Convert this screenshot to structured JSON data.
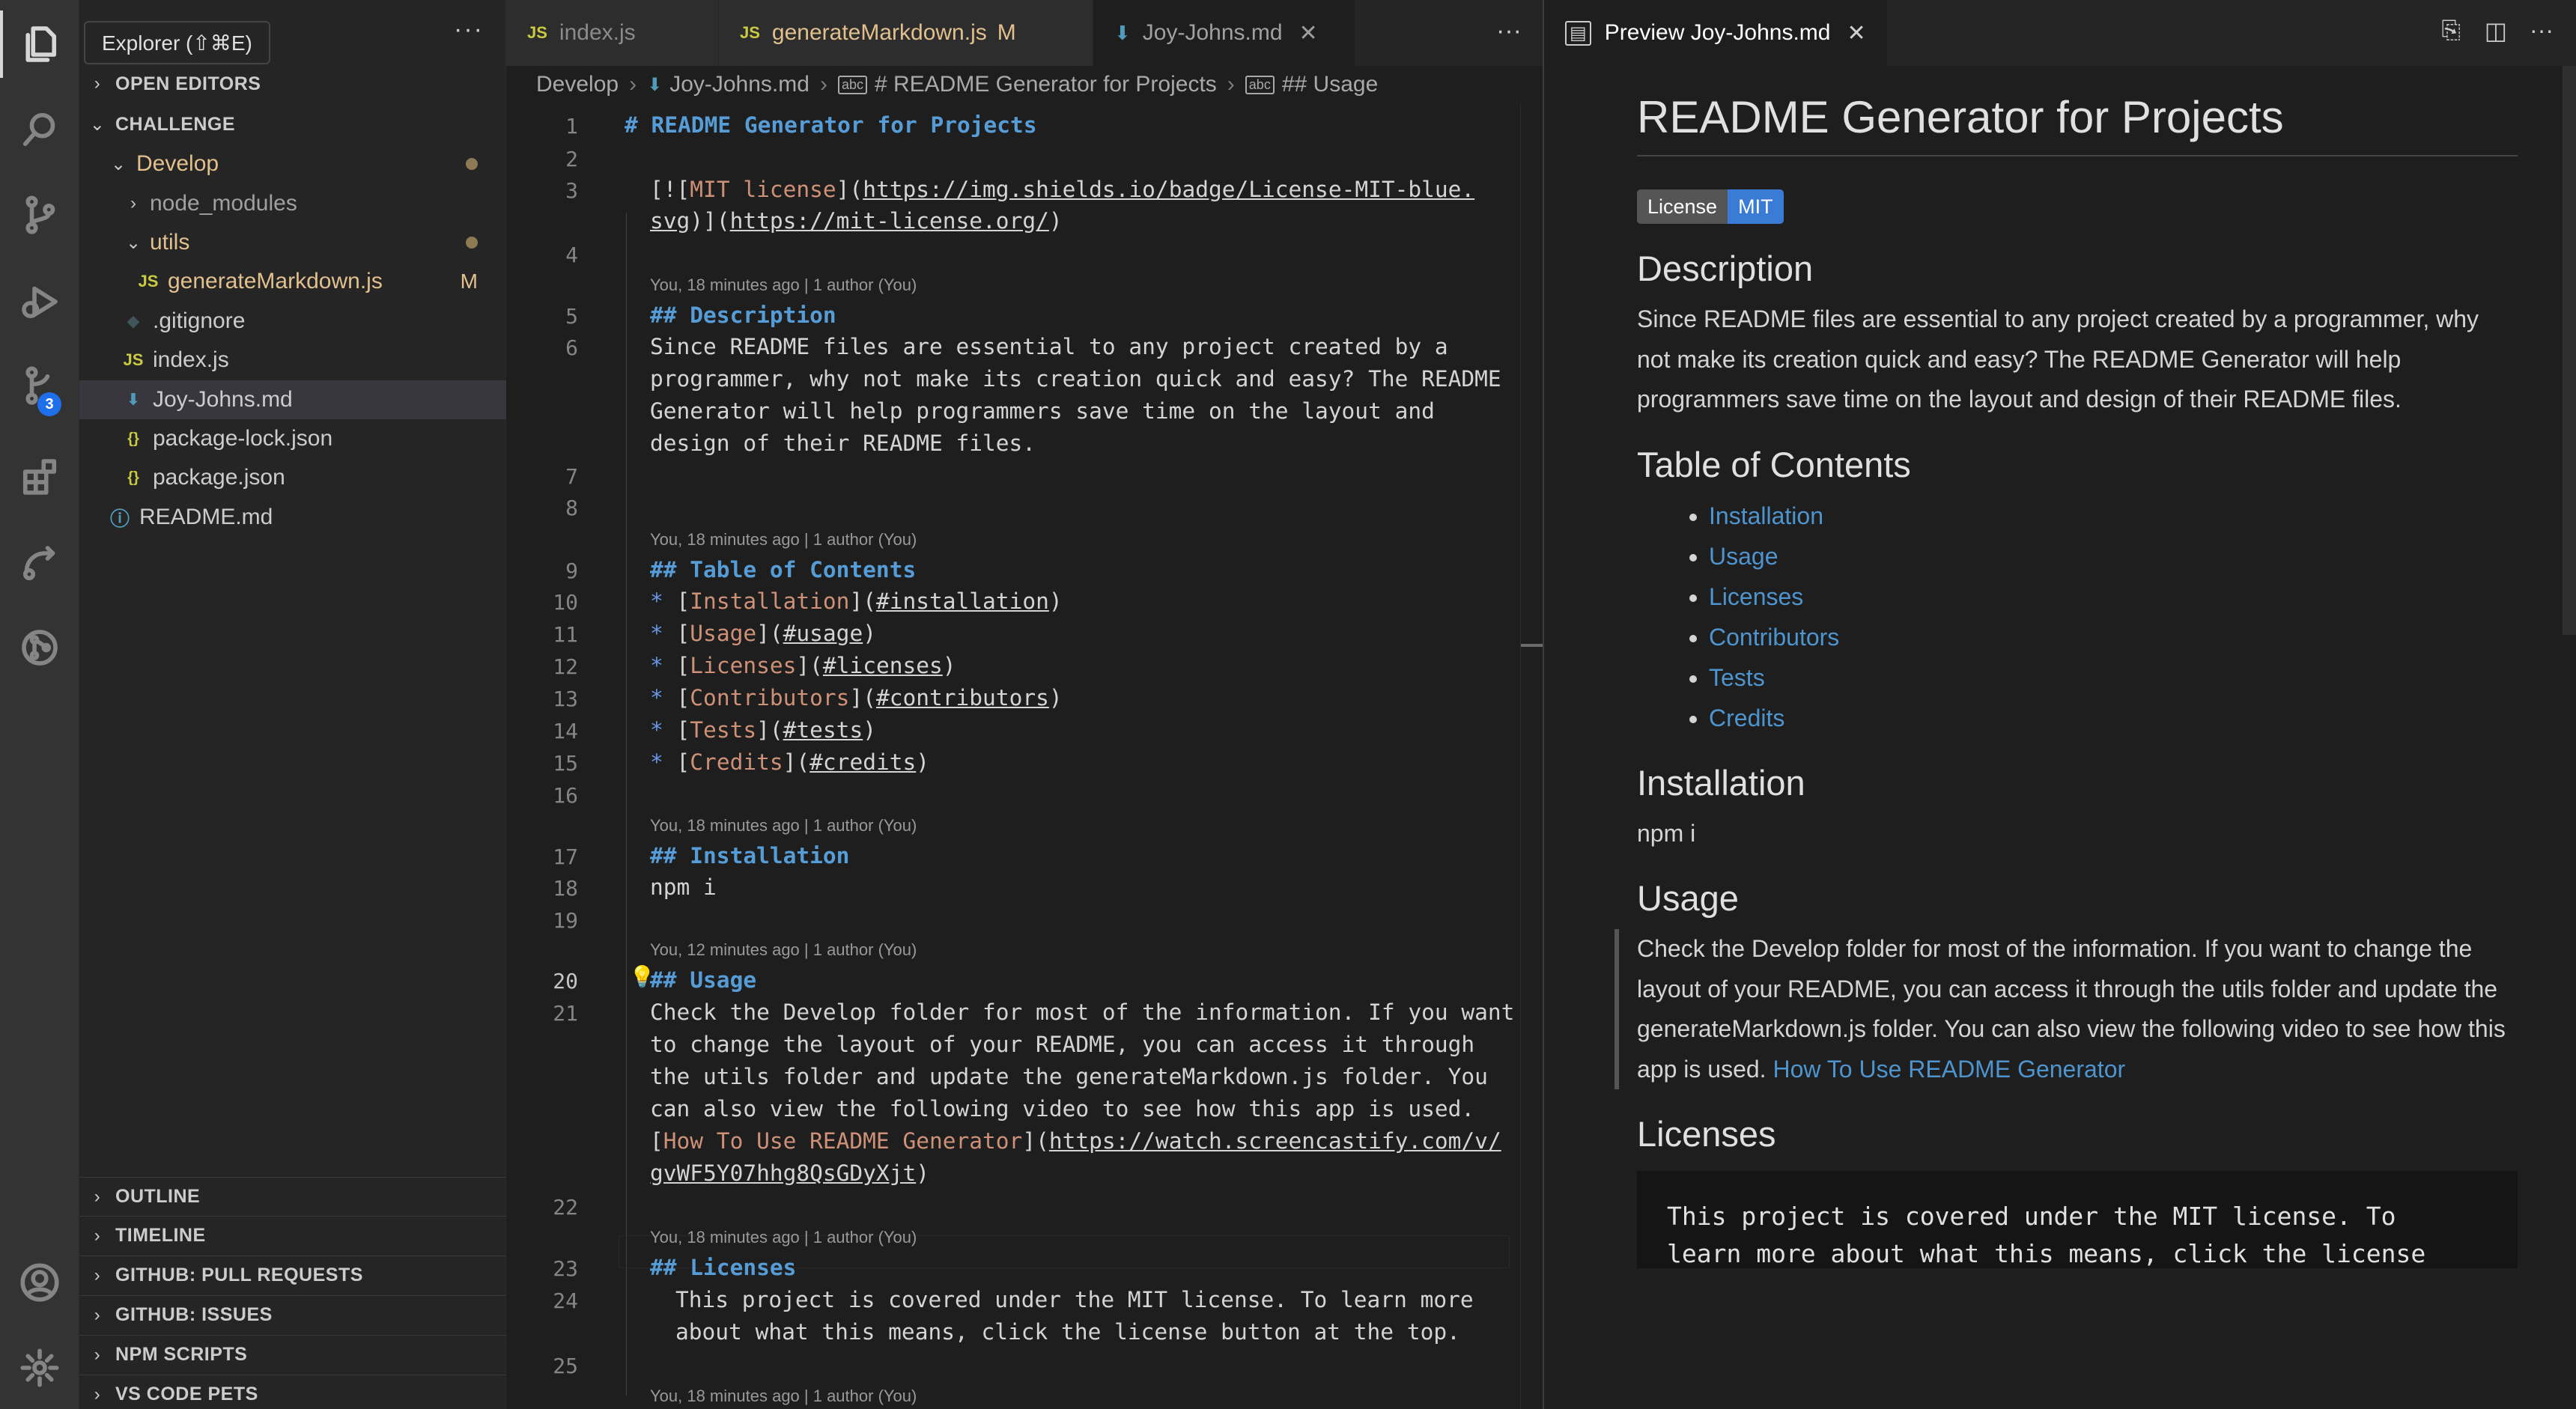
{
  "tooltip": "Explorer (⇧⌘E)",
  "activity": {
    "scm_badge": "3"
  },
  "sidebar": {
    "sections": {
      "open_editors": "OPEN EDITORS",
      "challenge": "CHALLENGE",
      "outline": "OUTLINE",
      "timeline": "TIMELINE",
      "gh_prs": "GITHUB: PULL REQUESTS",
      "gh_issues": "GITHUB: ISSUES",
      "npm": "NPM SCRIPTS",
      "pets": "VS CODE PETS"
    },
    "tree": {
      "develop": "Develop",
      "node_modules": "node_modules",
      "utils": "utils",
      "generate": "generateMarkdown.js",
      "generate_deco": "M",
      "gitignore": ".gitignore",
      "index": "index.js",
      "joy": "Joy-Johns.md",
      "lock": "package-lock.json",
      "pkg": "package.json",
      "readme": "README.md"
    }
  },
  "editor": {
    "tabs": {
      "t1": "index.js",
      "t2": "generateMarkdown.js",
      "t2_deco": "M",
      "t3": "Joy-Johns.md"
    },
    "breadcrumb": {
      "b1": "Develop",
      "b2": "Joy-Johns.md",
      "b3": "# README Generator for Projects",
      "b4": "## Usage"
    },
    "blame": {
      "b18": "You, 18 minutes ago | 1 author (You)",
      "b12": "You, 12 minutes ago | 1 author (You)"
    },
    "code": {
      "l1": "# README Generator for Projects",
      "l3a_open": "[![",
      "l3a_text": "MIT license",
      "l3a_mid": "](",
      "l3a_url": "https://img.shields.io/badge/License-MIT-blue.",
      "l3b_url": "svg",
      "l3b_mid": ")](",
      "l3b_url2": "https://mit-license.org/",
      "l3b_close": ")",
      "l5": "## Description",
      "l6a": "Since README files are essential to any project created by a",
      "l6b": "programmer, why not make its creation quick and easy? The README",
      "l6c": "Generator will help programmers save time on the layout and",
      "l6d": "design of their README files.",
      "l9": "## Table of Contents",
      "toc": [
        {
          "text": "Installation",
          "link": "#installation"
        },
        {
          "text": "Usage",
          "link": "#usage"
        },
        {
          "text": "Licenses",
          "link": "#licenses"
        },
        {
          "text": "Contributors",
          "link": "#contributors"
        },
        {
          "text": "Tests",
          "link": "#tests"
        },
        {
          "text": "Credits",
          "link": "#credits"
        }
      ],
      "l17": "## Installation",
      "l18": "npm i",
      "l20": "## Usage",
      "l21a": "Check the Develop folder for most of the information. If you want",
      "l21b": "to change the layout of your README, you can access it through",
      "l21c": "the utils folder and update the generateMarkdown.js folder. You",
      "l21d": "can also view the following video to see how this app is used.",
      "l21e_text": "How To Use README Generator",
      "l21e_url": "https://watch.screencastify.com/v/",
      "l21f_url": "gvWF5Y07hhg8QsGDyXjt",
      "l23": "## Licenses",
      "l24a": "This project is covered under the MIT license. To learn more",
      "l24b": "about what this means, click the license button at the top."
    }
  },
  "preview": {
    "tab": "Preview Joy-Johns.md",
    "h1": "README Generator for Projects",
    "badge_left": "License",
    "badge_right": "MIT",
    "h_desc": "Description",
    "p_desc": "Since README files are essential to any project created by a programmer, why not make its creation quick and easy? The README Generator will help programmers save time on the layout and design of their README files.",
    "h_toc": "Table of Contents",
    "toc": [
      "Installation",
      "Usage",
      "Licenses",
      "Contributors",
      "Tests",
      "Credits"
    ],
    "h_install": "Installation",
    "p_install": "npm i",
    "h_usage": "Usage",
    "p_usage": "Check the Develop folder for most of the information. If you want to change the layout of your README, you can access it through the utils folder and update the generateMarkdown.js folder. You can also view the following video to see how this app is used.",
    "usage_link": "How To Use README Generator",
    "h_licenses": "Licenses",
    "pre_licenses": "This project is covered under the MIT license. To\nlearn more about what this means, click the license"
  }
}
